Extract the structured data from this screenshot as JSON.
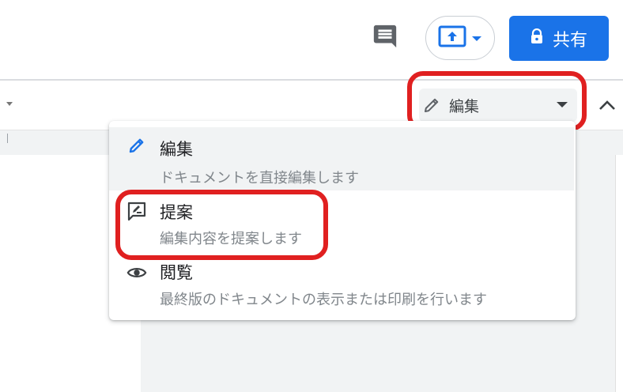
{
  "header": {
    "share_label": "共有",
    "accent_color": "#1a73e8"
  },
  "toolbar": {
    "mode_select_value": "編集"
  },
  "mode_menu": {
    "items": [
      {
        "title": "編集",
        "description": "ドキュメントを直接編集します",
        "icon": "pencil-icon",
        "selected": true
      },
      {
        "title": "提案",
        "description": "編集内容を提案します",
        "icon": "suggest-icon",
        "selected": false
      },
      {
        "title": "閲覧",
        "description": "最終版のドキュメントの表示または印刷を行います",
        "icon": "eye-icon",
        "selected": false
      }
    ]
  },
  "annotation_color": "#e02020"
}
